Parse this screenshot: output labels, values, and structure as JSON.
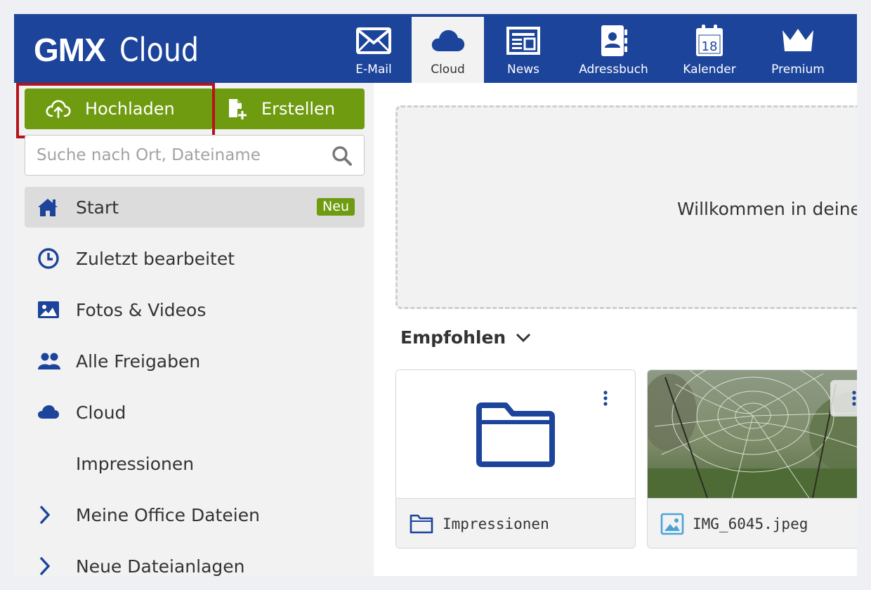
{
  "header": {
    "brand": "GMX",
    "product": "Cloud",
    "nav": [
      {
        "label": "E-Mail",
        "icon": "envelope-icon"
      },
      {
        "label": "Cloud",
        "icon": "cloud-icon",
        "active": true
      },
      {
        "label": "News",
        "icon": "newspaper-icon"
      },
      {
        "label": "Adressbuch",
        "icon": "addressbook-icon"
      },
      {
        "label": "Kalender",
        "icon": "calendar-icon",
        "day": "18"
      },
      {
        "label": "Premium",
        "icon": "crown-icon"
      }
    ]
  },
  "sidebar": {
    "upload_label": "Hochladen",
    "create_label": "Erstellen",
    "search_placeholder": "Suche nach Ort, Dateiname",
    "items": [
      {
        "label": "Start",
        "icon": "home-icon",
        "badge": "Neu",
        "active": true
      },
      {
        "label": "Zuletzt bearbeitet",
        "icon": "clock-icon"
      },
      {
        "label": "Fotos & Videos",
        "icon": "image-icon"
      },
      {
        "label": "Alle Freigaben",
        "icon": "users-icon"
      },
      {
        "label": "Cloud",
        "icon": "cloud-icon"
      },
      {
        "label": "Impressionen",
        "icon": ""
      },
      {
        "label": "Meine Office Dateien",
        "icon": "chevron-right-icon"
      },
      {
        "label": "Neue Dateianlagen",
        "icon": "chevron-right-icon"
      }
    ]
  },
  "main": {
    "welcome_text": "Willkommen in deine",
    "section_title": "Empfohlen",
    "cards": [
      {
        "name": "Impressionen",
        "type": "folder"
      },
      {
        "name": "IMG_6045.jpeg",
        "type": "image"
      }
    ]
  },
  "colors": {
    "brand_blue": "#1c449b",
    "action_green": "#6f9b10",
    "highlight_red": "#b3141b"
  }
}
